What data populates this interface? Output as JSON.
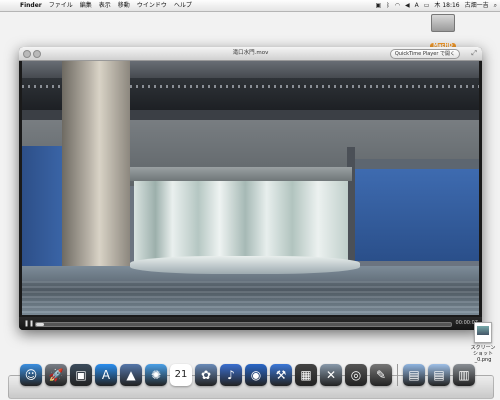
{
  "menubar": {
    "apple_glyph": "",
    "menus": [
      "Finder",
      "ファイル",
      "編集",
      "表示",
      "移動",
      "ウインドウ",
      "ヘルプ"
    ],
    "clock": "木 18:16",
    "user": "古畑一吉"
  },
  "desktop": {
    "hd_label": "MacHD",
    "screenshot_label_line1": "スクリーン",
    "screenshot_label_line2": "ショット_0.png"
  },
  "quicktime": {
    "title": "滝口水門.mov",
    "open_button": "QuickTime Player で開く",
    "elapsed": "00:00:07",
    "progress": 0.02
  },
  "dock": {
    "items": [
      {
        "name": "finder-icon",
        "glyph": "☺",
        "color": "#3b8fe0"
      },
      {
        "name": "rocket-icon",
        "glyph": "🚀",
        "color": "#7a7f87"
      },
      {
        "name": "dashboard-icon",
        "glyph": "▣",
        "color": "#3c4c5c"
      },
      {
        "name": "appstore-icon",
        "glyph": "A",
        "color": "#2b8ff0"
      },
      {
        "name": "preview-icon",
        "glyph": "▲",
        "color": "#5577aa"
      },
      {
        "name": "safari-icon",
        "glyph": "✺",
        "color": "#4aa0e8"
      },
      {
        "name": "calendar-icon",
        "glyph": "21",
        "color": "#e23a33"
      },
      {
        "name": "photos-icon",
        "glyph": "✿",
        "color": "#6a8bb8"
      },
      {
        "name": "itunes-icon",
        "glyph": "♪",
        "color": "#3b6fd0"
      },
      {
        "name": "dvd-icon",
        "glyph": "◉",
        "color": "#2a67c8"
      },
      {
        "name": "xcode-icon",
        "glyph": "⚒",
        "color": "#3c78d8"
      },
      {
        "name": "photobooth-icon",
        "glyph": "▦",
        "color": "#444"
      },
      {
        "name": "utility-icon",
        "glyph": "✕",
        "color": "#8899aa"
      },
      {
        "name": "camera-icon",
        "glyph": "◎",
        "color": "#555"
      },
      {
        "name": "script-icon",
        "glyph": "✎",
        "color": "#777"
      },
      {
        "name": "folder-apps-icon",
        "glyph": "▤",
        "color": "#8fb4e0"
      },
      {
        "name": "folder-docs-icon",
        "glyph": "▤",
        "color": "#9fc0e8"
      },
      {
        "name": "trash-icon",
        "glyph": "▥",
        "color": "#8a8f95"
      }
    ]
  }
}
